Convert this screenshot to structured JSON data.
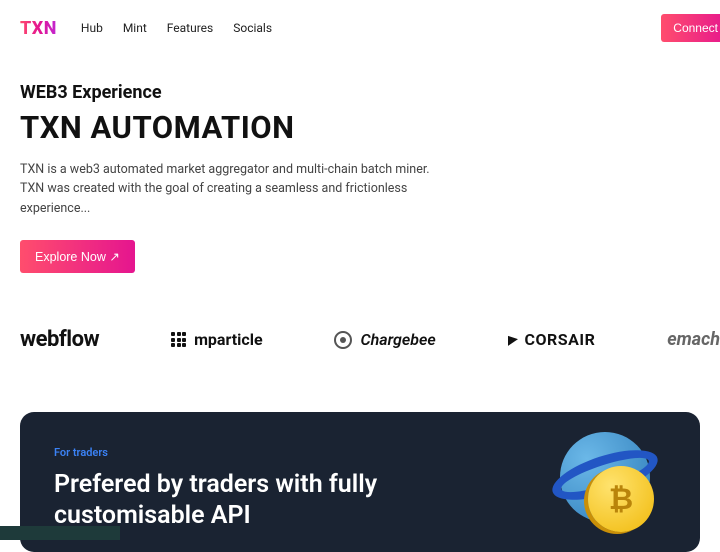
{
  "nav": {
    "logo": "TXN",
    "links": [
      "Hub",
      "Mint",
      "Features",
      "Socials"
    ],
    "connect": "Connect"
  },
  "hero": {
    "eyebrow": "WEB3 Experience",
    "headline": "TXN AUTOMATION",
    "desc": "TXN is a web3 automated market aggregator and multi-chain batch miner. TXN was created with the goal of creating a seamless and frictionless experience...",
    "cta": "Explore Now ↗"
  },
  "brands": {
    "webflow": "webflow",
    "mparticle": "mparticle",
    "chargebee": "Chargebee",
    "corsair": "CORSAIR",
    "emach": "emach"
  },
  "panel": {
    "eyebrow": "For traders",
    "title": "Prefered by traders with fully customisable API",
    "coin": "₿"
  }
}
